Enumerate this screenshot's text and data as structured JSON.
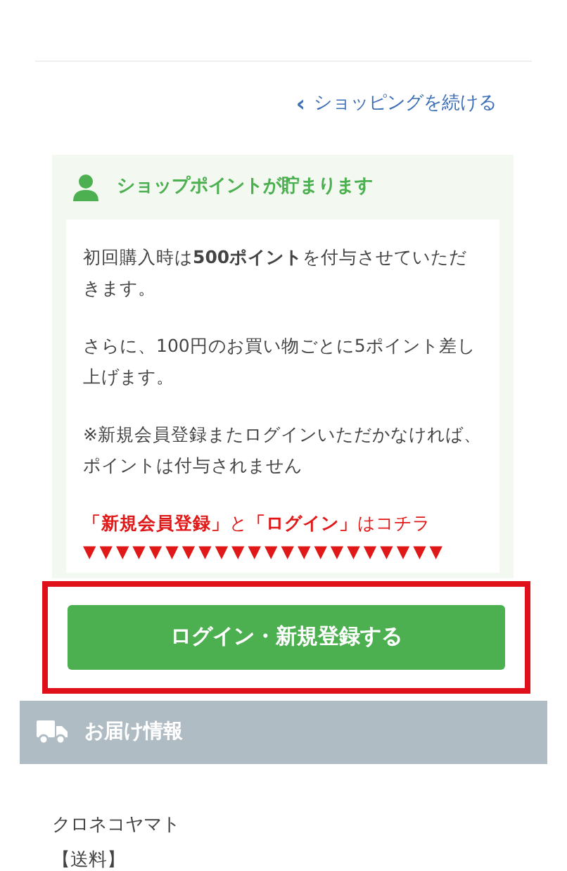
{
  "continue_link": {
    "icon": "‹",
    "label": "ショッピングを続ける"
  },
  "points_panel": {
    "title": "ショップポイントが貯まります",
    "paragraphs": [
      "初回購入時は**500ポイント**を付与させていただきます。",
      "さらに、100円のお買い物ごとに5ポイント差し上げます。",
      "※新規会員登録またログインいただかなければ、ポイントは付与されません"
    ],
    "callout": "**「新規会員登録」**と**「ログイン」**はコチラ",
    "arrows": "▼▼▼▼▼▼▼▼▼▼▼▼▼▼▼▼▼▼▼▼▼▼"
  },
  "login_button": {
    "label": "ログイン・新規登録する",
    "highlighted": true
  },
  "delivery_section": {
    "title": "お届け情報",
    "carrier": "クロネコヤマト",
    "shipping_label": "【送料】"
  }
}
